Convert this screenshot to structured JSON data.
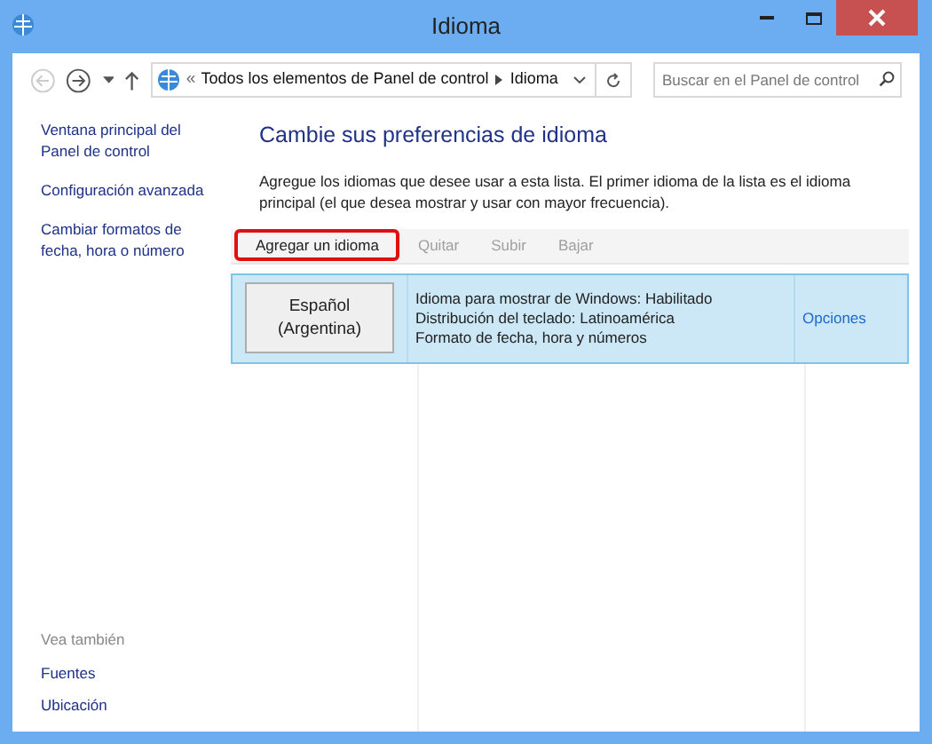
{
  "window": {
    "title": "Idioma"
  },
  "address_bar": {
    "separator": "«",
    "path": [
      {
        "label": "Todos los elementos de Panel de control"
      },
      {
        "label": "Idioma"
      }
    ]
  },
  "search": {
    "placeholder": "Buscar en el Panel de control"
  },
  "sidebar": {
    "items": [
      {
        "label": "Ventana principal del Panel de control"
      },
      {
        "label": "Configuración avanzada"
      },
      {
        "label": "Cambiar formatos de fecha, hora o número"
      }
    ],
    "see_also": {
      "heading": "Vea también",
      "items": [
        {
          "label": "Fuentes"
        },
        {
          "label": "Ubicación"
        }
      ]
    }
  },
  "main": {
    "heading": "Cambie sus preferencias de idioma",
    "description": "Agregue los idiomas que desee usar a esta lista. El primer idioma de la lista es el idioma principal (el que desea mostrar y usar con mayor frecuencia).",
    "toolbar": [
      {
        "label": "Agregar un idioma",
        "disabled": false,
        "highlighted": true
      },
      {
        "label": "Quitar",
        "disabled": true,
        "highlighted": false
      },
      {
        "label": "Subir",
        "disabled": true,
        "highlighted": false
      },
      {
        "label": "Bajar",
        "disabled": true,
        "highlighted": false
      }
    ],
    "languages": [
      {
        "name": "Español (Argentina)",
        "details": [
          "Idioma para mostrar de Windows: Habilitado",
          "Distribución del teclado: Latinoamérica",
          "Formato de fecha, hora y números"
        ],
        "options": "Opciones",
        "selected": true
      }
    ]
  }
}
